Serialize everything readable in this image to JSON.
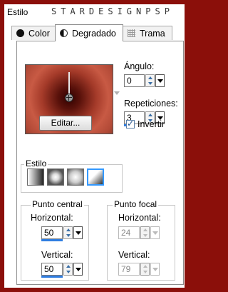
{
  "window": {
    "title": "Estilo",
    "watermark": "STARDESIGNPSP"
  },
  "tabs": [
    {
      "label": "Color",
      "icon": "circle-icon"
    },
    {
      "label": "Degradado",
      "icon": "half-circle-icon"
    },
    {
      "label": "Trama",
      "icon": "grid-pattern-icon"
    }
  ],
  "active_tab": "Degradado",
  "angle": {
    "label": "Ángulo:",
    "value": "0"
  },
  "repetitions": {
    "label": "Repeticiones:",
    "value": "3",
    "level": 0.03
  },
  "edit_button": "Editar...",
  "invert": {
    "label": "Invertir",
    "checked": true
  },
  "style_group": {
    "title": "Estilo",
    "options": [
      "linear",
      "rectangular",
      "radial",
      "sunburst"
    ],
    "selected": "sunburst"
  },
  "center_point": {
    "title": "Punto central",
    "horizontal": {
      "label": "Horizontal:",
      "value": "50",
      "level": 0.5
    },
    "vertical": {
      "label": "Vertical:",
      "value": "50",
      "level": 0.5
    }
  },
  "focal_point": {
    "title": "Punto focal",
    "horizontal": {
      "label": "Horizontal:",
      "value": "24"
    },
    "vertical": {
      "label": "Vertical:",
      "value": "79"
    }
  },
  "colors": {
    "gradient_dark": "#2a0201",
    "gradient_light": "#c85a44",
    "accent": "#2f7de1",
    "frame": "#8b0f0a"
  }
}
